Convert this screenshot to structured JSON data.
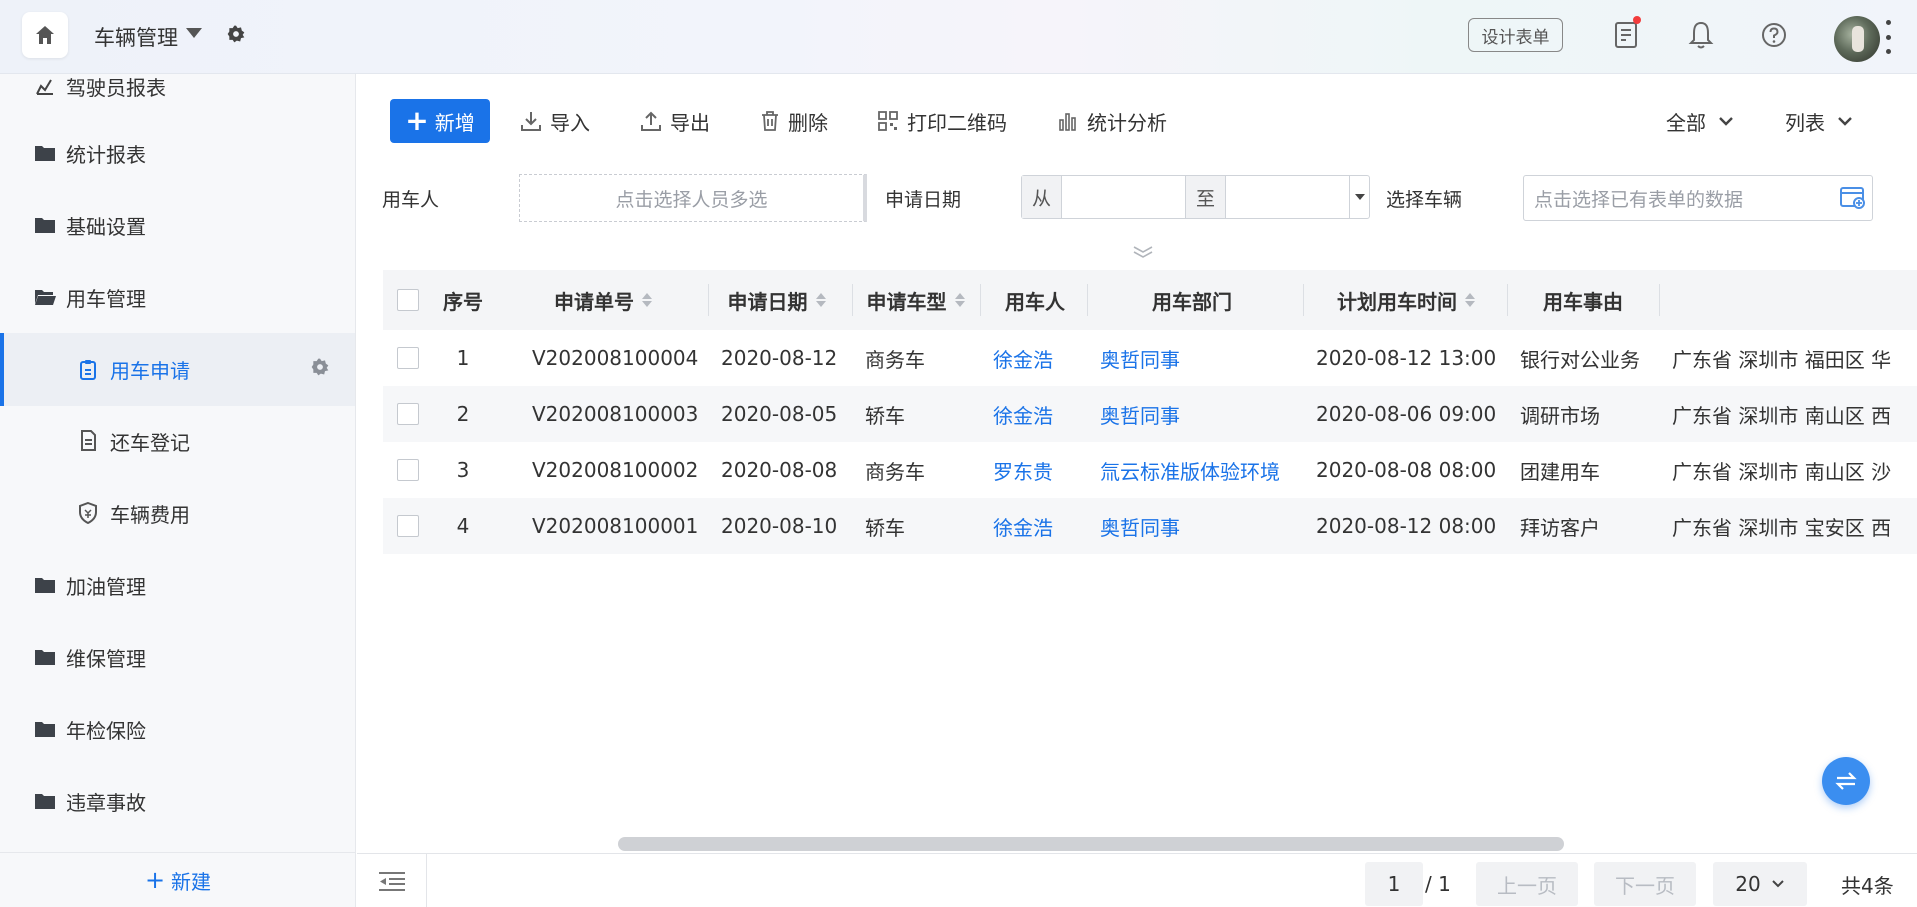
{
  "header": {
    "app_title": "车辆管理",
    "design_button": "设计表单",
    "icons": [
      "home-icon",
      "caret-down-icon",
      "gear-icon",
      "document-icon",
      "bell-icon",
      "help-icon",
      "avatar",
      "more-vertical-icon"
    ]
  },
  "sidebar": {
    "items": [
      {
        "label": "驾驶员报表",
        "icon": "chart-icon"
      },
      {
        "label": "统计报表",
        "icon": "folder-icon"
      },
      {
        "label": "基础设置",
        "icon": "folder-icon"
      },
      {
        "label": "用车管理",
        "icon": "folder-open-icon"
      },
      {
        "label": "用车申请",
        "icon": "clipboard-icon"
      },
      {
        "label": "还车登记",
        "icon": "document-icon"
      },
      {
        "label": "车辆费用",
        "icon": "shield-icon"
      },
      {
        "label": "加油管理",
        "icon": "folder-icon"
      },
      {
        "label": "维保管理",
        "icon": "folder-icon"
      },
      {
        "label": "年检保险",
        "icon": "folder-icon"
      },
      {
        "label": "违章事故",
        "icon": "folder-icon"
      }
    ],
    "new_label": "新建"
  },
  "toolbar": {
    "add": "新增",
    "import": "导入",
    "export": "导出",
    "delete": "删除",
    "print_qr": "打印二维码",
    "stats": "统计分析",
    "scope": "全部",
    "view": "列表"
  },
  "filters": {
    "user_label": "用车人",
    "user_placeholder": "点击选择人员多选",
    "date_label": "申请日期",
    "date_from": "从",
    "date_to": "至",
    "vehicle_label": "选择车辆",
    "vehicle_placeholder": "点击选择已有表单的数据"
  },
  "table": {
    "headers": {
      "index": "序号",
      "order_no": "申请单号",
      "apply_date": "申请日期",
      "car_type": "申请车型",
      "user": "用车人",
      "dept": "用车部门",
      "plan_time": "计划用车时间",
      "reason": "用车事由"
    },
    "rows": [
      {
        "index": "1",
        "order_no": "V202008100004",
        "apply_date": "2020-08-12",
        "car_type": "商务车",
        "user": "徐金浩",
        "dept": "奥哲同事",
        "plan_time": "2020-08-12 13:00",
        "reason": "银行对公业务",
        "address": "广东省 深圳市 福田区 华"
      },
      {
        "index": "2",
        "order_no": "V202008100003",
        "apply_date": "2020-08-05",
        "car_type": "轿车",
        "user": "徐金浩",
        "dept": "奥哲同事",
        "plan_time": "2020-08-06 09:00",
        "reason": "调研市场",
        "address": "广东省 深圳市 南山区 西"
      },
      {
        "index": "3",
        "order_no": "V202008100002",
        "apply_date": "2020-08-08",
        "car_type": "商务车",
        "user": "罗东贵",
        "dept": "氚云标准版体验环境",
        "plan_time": "2020-08-08 08:00",
        "reason": "团建用车",
        "address": "广东省 深圳市 南山区 沙"
      },
      {
        "index": "4",
        "order_no": "V202008100001",
        "apply_date": "2020-08-10",
        "car_type": "轿车",
        "user": "徐金浩",
        "dept": "奥哲同事",
        "plan_time": "2020-08-12 08:00",
        "reason": "拜访客户",
        "address": "广东省 深圳市 宝安区 西"
      }
    ]
  },
  "pagination": {
    "current": "1",
    "total_pages": "/ 1",
    "prev": "上一页",
    "next": "下一页",
    "page_size": "20",
    "total": "共4条"
  },
  "colors": {
    "accent": "#1a73e8",
    "sidebar_bg": "#f7f8fa"
  }
}
